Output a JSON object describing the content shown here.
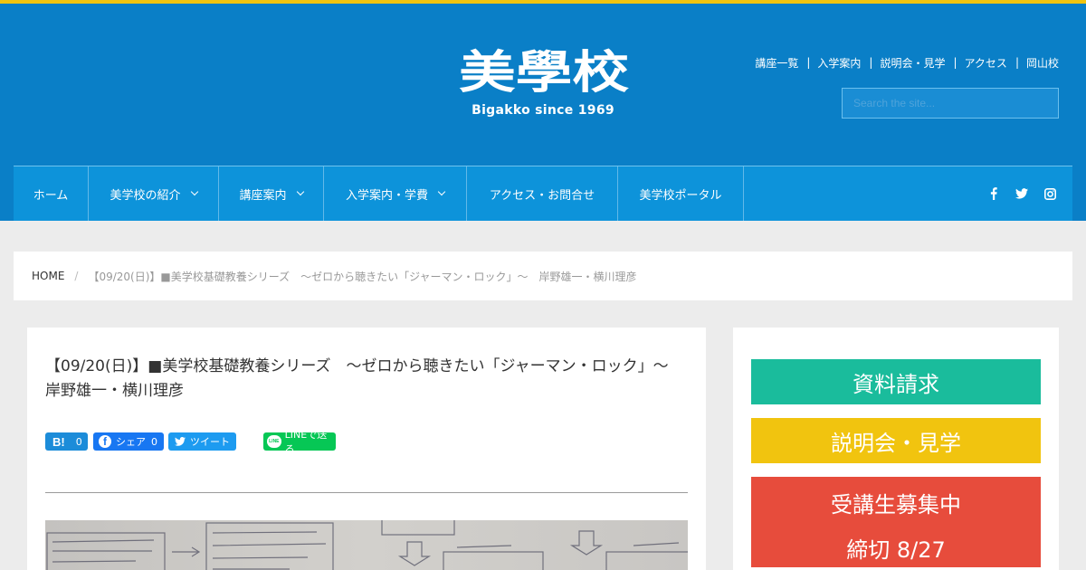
{
  "colors": {
    "header_bg": "#0a7fc7",
    "top_accent": "#f1c40f",
    "nav_bg": "#0d93da",
    "cta_teal": "#1abc9c",
    "cta_yellow": "#f1c40f",
    "cta_red": "#e74c3c"
  },
  "header": {
    "logo_text": "美學校",
    "logo_tagline": "Bigakko since 1969",
    "top_links": [
      "講座一覧",
      "入学案内",
      "説明会・見学",
      "アクセス",
      "岡山校"
    ],
    "top_link_separator": "|",
    "search_placeholder": "Search the site..."
  },
  "nav": {
    "items": [
      {
        "label": "ホーム"
      },
      {
        "label": "美学校の紹介"
      },
      {
        "label": "講座案内"
      },
      {
        "label": "入学案内・学費"
      },
      {
        "label": "アクセス・お問合せ"
      },
      {
        "label": "美学校ポータル"
      }
    ],
    "social_icons": [
      "facebook-icon",
      "twitter-icon",
      "instagram-icon"
    ]
  },
  "breadcrumb": {
    "home": "HOME",
    "separator": "/",
    "current": "【09/20(日)】■美学校基礎教養シリーズ　〜ゼロから聴きたい「ジャーマン・ロック」〜　岸野雄一・横川理彦"
  },
  "article": {
    "title": "【09/20(日)】■美学校基礎教養シリーズ　〜ゼロから聴きたい「ジャーマン・ロック」〜　岸野雄一・横川理彦",
    "share": {
      "hatena_mark": "B!",
      "hatena_count": "0",
      "facebook_label": "シェア",
      "facebook_count": "0",
      "twitter_label": "ツイート",
      "line_label": "LINEで送る",
      "line_logo": "LINE"
    }
  },
  "sidebar": {
    "brochure_button": "資料請求",
    "session_button": "説明会・見学",
    "recruit_title": "受講生募集中",
    "recruit_deadline": "締切 8/27"
  }
}
